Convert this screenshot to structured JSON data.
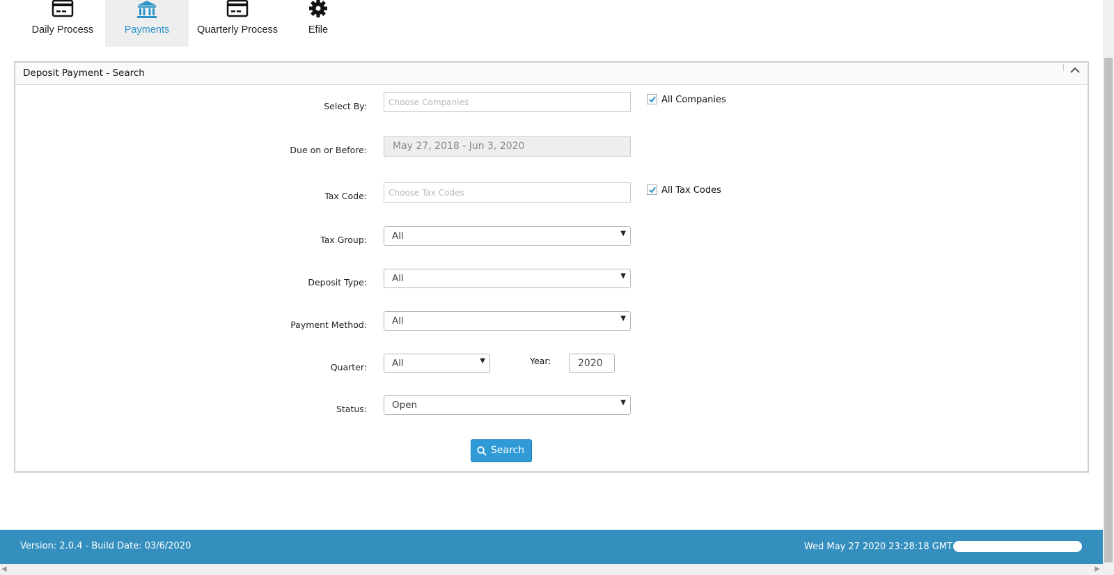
{
  "tabs": [
    {
      "label": "Daily Process",
      "icon": "credit-card-icon"
    },
    {
      "label": "Payments",
      "icon": "bank-icon"
    },
    {
      "label": "Quarterly Process",
      "icon": "credit-card-icon"
    },
    {
      "label": "Efile",
      "icon": "gear-icon"
    }
  ],
  "active_tab": "Payments",
  "panel": {
    "title": "Deposit Payment - Search"
  },
  "form": {
    "select_by": {
      "label": "Select By:",
      "placeholder": "Choose Companies",
      "checkbox_label": "All Companies",
      "checked": true
    },
    "due_on_or_before": {
      "label": "Due on or Before:",
      "value": "May 27, 2018 - Jun 3, 2020"
    },
    "tax_code": {
      "label": "Tax Code:",
      "placeholder": "Choose Tax Codes",
      "checkbox_label": "All Tax Codes",
      "checked": true
    },
    "tax_group": {
      "label": "Tax Group:",
      "value": "All"
    },
    "deposit_type": {
      "label": "Deposit Type:",
      "value": "All"
    },
    "payment_method": {
      "label": "Payment Method:",
      "value": "All"
    },
    "quarter": {
      "label": "Quarter:",
      "value": "All"
    },
    "year": {
      "label": "Year:",
      "value": "2020"
    },
    "status": {
      "label": "Status:",
      "value": "Open"
    },
    "search_button": "Search"
  },
  "footer": {
    "version": "Version: 2.0.4 - Build Date: 03/6/2020",
    "datetime": "Wed May 27 2020 23:28:18 GMT"
  },
  "colors": {
    "accent": "#2b94c6",
    "footer": "#348fbf",
    "button": "#2f9ad6"
  }
}
